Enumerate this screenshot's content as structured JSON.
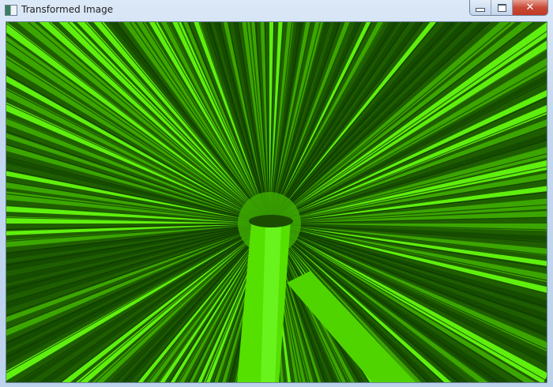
{
  "window": {
    "title": "Transformed Image",
    "controls": {
      "minimize": "minimize",
      "maximize": "maximize",
      "close": "close"
    }
  },
  "image": {
    "colors": {
      "dark": "#144a00",
      "mid": "#3fae00",
      "bright": "#66ff10",
      "base": "#1f5e00"
    }
  }
}
